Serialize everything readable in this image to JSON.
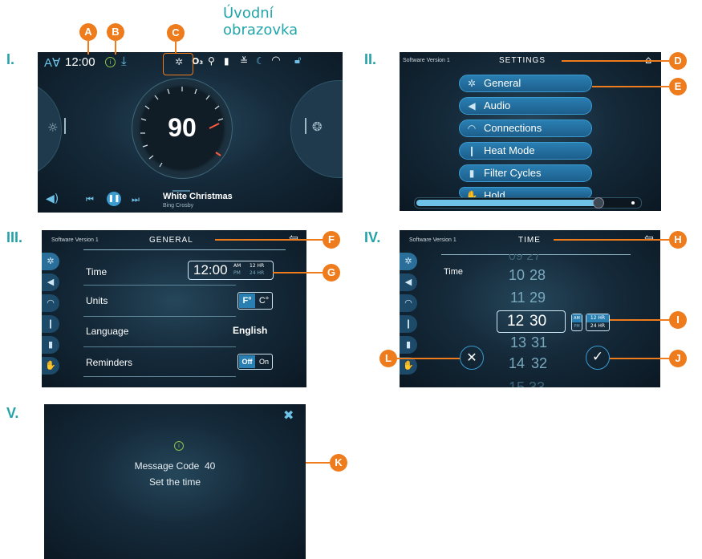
{
  "heading": "Úvodní\nobrazovka",
  "roman": [
    "I.",
    "II.",
    "III.",
    "IV.",
    "V."
  ],
  "badges": [
    "A",
    "B",
    "C",
    "D",
    "E",
    "F",
    "G",
    "H",
    "I",
    "J",
    "K",
    "L"
  ],
  "home": {
    "font_icon": "A∀",
    "time": "12:00",
    "temperature": "90",
    "song_title": "White Christmas",
    "song_artist": "Bing Crosby",
    "status_icons": [
      "info-icon",
      "download-icon",
      "gear-icon",
      "ozone-icon",
      "cleaning-icon",
      "filter-icon",
      "heater-icon",
      "moon-icon",
      "wifi-icon",
      "lock-icon"
    ]
  },
  "settings": {
    "software_version": "Software Version 1",
    "title": "SETTINGS",
    "items": [
      {
        "label": "General",
        "icon": "gear-icon"
      },
      {
        "label": "Audio",
        "icon": "speaker-icon"
      },
      {
        "label": "Connections",
        "icon": "wifi-icon"
      },
      {
        "label": "Heat Mode",
        "icon": "thermometer-icon"
      },
      {
        "label": "Filter Cycles",
        "icon": "filter-icon"
      },
      {
        "label": "Hold",
        "icon": "hand-icon"
      }
    ]
  },
  "general": {
    "software_version": "Software Version 1",
    "title": "GENERAL",
    "time_label": "Time",
    "time_value": "12:00",
    "am": "AM",
    "pm": "PM",
    "hr12": "12 HR",
    "hr24": "24 HR",
    "units_label": "Units",
    "unit_f": "F°",
    "unit_c": "C°",
    "language_label": "Language",
    "language_value": "English",
    "reminders_label": "Reminders",
    "off": "Off",
    "on": "On"
  },
  "time_screen": {
    "software_version": "Software Version 1",
    "title": "TIME",
    "time_label": "Time",
    "hours_above": [
      "10",
      "11"
    ],
    "minutes_above": [
      "28",
      "29"
    ],
    "hour_selected": "12",
    "minute_selected": "30",
    "hours_below": [
      "13",
      "14"
    ],
    "minutes_below": [
      "31",
      "32"
    ],
    "am": "AM",
    "pm": "PM",
    "hr12": "12 HR",
    "hr24": "24 HR"
  },
  "message": {
    "code_line": "Message Code  40",
    "text": "Set the time"
  }
}
